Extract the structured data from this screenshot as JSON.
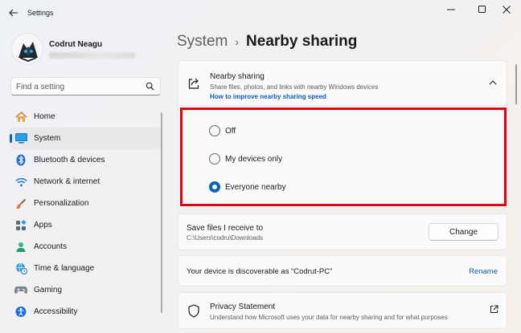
{
  "window": {
    "title": "Settings"
  },
  "user": {
    "name": "Codrut Neagu"
  },
  "search": {
    "placeholder": "Find a setting"
  },
  "sidebar": {
    "items": [
      {
        "label": "Home",
        "icon": "home-icon"
      },
      {
        "label": "System",
        "icon": "monitor-icon",
        "active": true
      },
      {
        "label": "Bluetooth & devices",
        "icon": "bluetooth-icon"
      },
      {
        "label": "Network & internet",
        "icon": "wifi-icon"
      },
      {
        "label": "Personalization",
        "icon": "brush-icon"
      },
      {
        "label": "Apps",
        "icon": "apps-icon"
      },
      {
        "label": "Accounts",
        "icon": "person-icon"
      },
      {
        "label": "Time & language",
        "icon": "globe-clock-icon"
      },
      {
        "label": "Gaming",
        "icon": "gamepad-icon"
      },
      {
        "label": "Accessibility",
        "icon": "accessibility-icon"
      }
    ]
  },
  "breadcrumb": {
    "parent": "System",
    "current": "Nearby sharing"
  },
  "nearby": {
    "title": "Nearby sharing",
    "description": "Share files, photos, and links with nearby Windows devices",
    "help_link": "How to improve nearby sharing speed",
    "options": [
      {
        "label": "Off",
        "checked": false
      },
      {
        "label": "My devices only",
        "checked": false
      },
      {
        "label": "Everyone nearby",
        "checked": true
      }
    ]
  },
  "save_files": {
    "title": "Save files I receive to",
    "path": "C:\\Users\\codru\\Downloads",
    "button": "Change"
  },
  "discoverable": {
    "text": "Your device is discoverable as “Codrut-PC”",
    "action": "Rename"
  },
  "privacy": {
    "title": "Privacy Statement",
    "description": "Understand how Microsoft uses your data for nearby sharing and for what purposes"
  },
  "colors": {
    "accent": "#0067c0",
    "highlight": "#e3000f",
    "link": "#0f5bb5"
  }
}
